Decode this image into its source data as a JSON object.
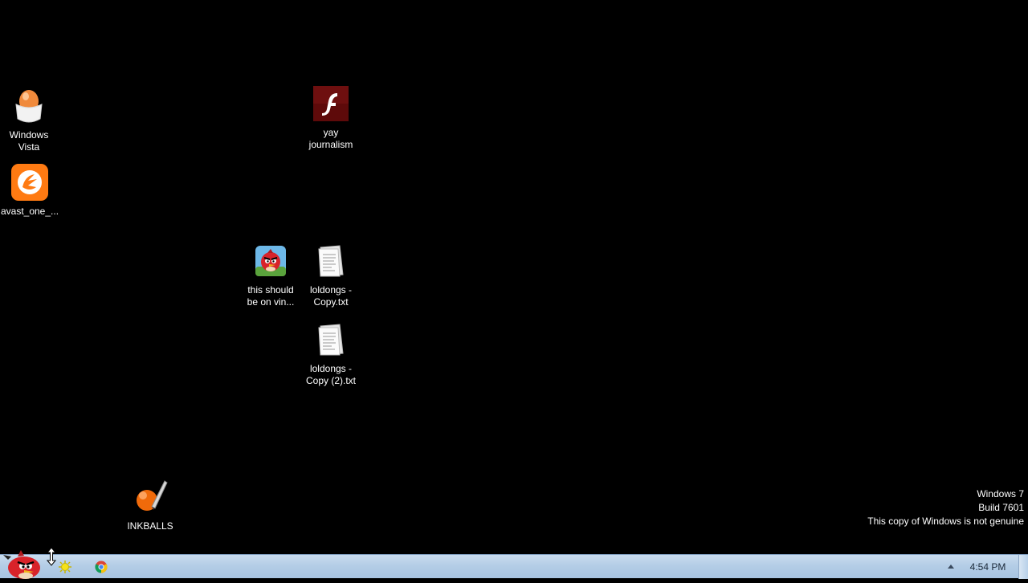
{
  "desktop": {
    "icons": [
      {
        "label": "Windows\nVista",
        "icon": "egg-icon"
      },
      {
        "label": "avast_one_...",
        "icon": "avast-icon"
      },
      {
        "label": "yay\njournalism",
        "icon": "flash-icon"
      },
      {
        "label": "this should\nbe on vin...",
        "icon": "angry-birds-icon"
      },
      {
        "label": "loldongs -\nCopy.txt",
        "icon": "text-file-icon"
      },
      {
        "label": "loldongs -\nCopy (2).txt",
        "icon": "text-file-icon"
      },
      {
        "label": "INKBALLS",
        "icon": "inkball-icon"
      }
    ]
  },
  "watermark": {
    "line1": "Windows 7",
    "line2": "Build 7601",
    "line3": "This copy of Windows is not genuine"
  },
  "taskbar": {
    "start_icon": "angry-bird-start-icon",
    "pinned": [
      "sun-app-icon",
      "chrome-icon"
    ],
    "tray_arrow": "show-hidden-icons-arrow",
    "clock": "4:54 PM"
  },
  "colors": {
    "desktop_bg": "#000000",
    "taskbar_bg": "#b4cde6",
    "label_text": "#ffffff"
  }
}
